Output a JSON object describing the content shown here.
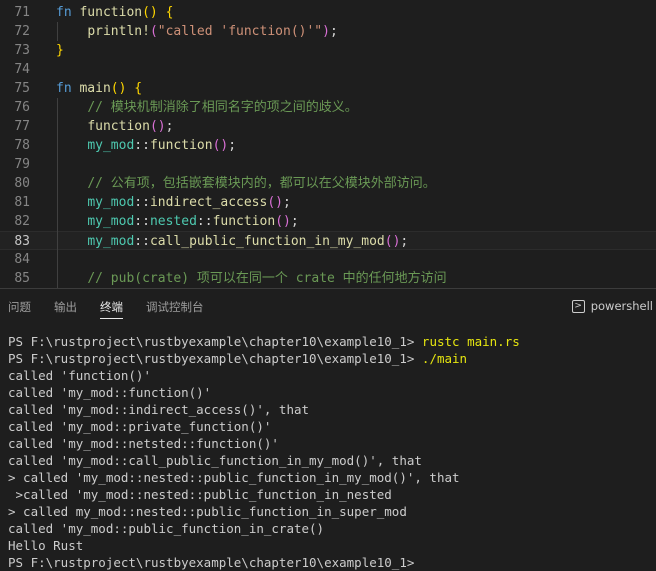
{
  "editor": {
    "lines": [
      {
        "num": "71",
        "tokens": [
          [
            "kw",
            "fn "
          ],
          [
            "fn",
            "function"
          ],
          [
            "br1",
            "() {"
          ]
        ]
      },
      {
        "num": "72",
        "tokens": [
          [
            "pl",
            "    "
          ],
          [
            "fn",
            "println!"
          ],
          [
            "br2",
            "("
          ],
          [
            "str",
            "\"called 'function()'\""
          ],
          [
            "br2",
            ")"
          ],
          [
            "pl",
            ";"
          ]
        ]
      },
      {
        "num": "73",
        "tokens": [
          [
            "br1",
            "}"
          ]
        ]
      },
      {
        "num": "74",
        "tokens": []
      },
      {
        "num": "75",
        "tokens": [
          [
            "kw",
            "fn "
          ],
          [
            "fn",
            "main"
          ],
          [
            "br1",
            "() {"
          ]
        ]
      },
      {
        "num": "76",
        "tokens": [
          [
            "pl",
            "    "
          ],
          [
            "cm",
            "// 模块机制消除了相同名字的项之间的歧义。"
          ]
        ]
      },
      {
        "num": "77",
        "tokens": [
          [
            "pl",
            "    "
          ],
          [
            "fn",
            "function"
          ],
          [
            "br2",
            "()"
          ],
          [
            "pl",
            ";"
          ]
        ]
      },
      {
        "num": "78",
        "tokens": [
          [
            "pl",
            "    "
          ],
          [
            "mod",
            "my_mod"
          ],
          [
            "pl",
            "::"
          ],
          [
            "fn",
            "function"
          ],
          [
            "br2",
            "()"
          ],
          [
            "pl",
            ";"
          ]
        ]
      },
      {
        "num": "79",
        "tokens": []
      },
      {
        "num": "80",
        "tokens": [
          [
            "pl",
            "    "
          ],
          [
            "cm",
            "// 公有项，包括嵌套模块内的，都可以在父模块外部访问。"
          ]
        ]
      },
      {
        "num": "81",
        "tokens": [
          [
            "pl",
            "    "
          ],
          [
            "mod",
            "my_mod"
          ],
          [
            "pl",
            "::"
          ],
          [
            "fn",
            "indirect_access"
          ],
          [
            "br2",
            "()"
          ],
          [
            "pl",
            ";"
          ]
        ]
      },
      {
        "num": "82",
        "tokens": [
          [
            "pl",
            "    "
          ],
          [
            "mod",
            "my_mod"
          ],
          [
            "pl",
            "::"
          ],
          [
            "mod",
            "nested"
          ],
          [
            "pl",
            "::"
          ],
          [
            "fn",
            "function"
          ],
          [
            "br2",
            "()"
          ],
          [
            "pl",
            ";"
          ]
        ]
      },
      {
        "num": "83",
        "tokens": [
          [
            "pl",
            "    "
          ],
          [
            "mod",
            "my_mod"
          ],
          [
            "pl",
            "::"
          ],
          [
            "fn",
            "call_public_function_in_my_mod"
          ],
          [
            "br2",
            "()"
          ],
          [
            "pl",
            ";"
          ]
        ],
        "current": true
      },
      {
        "num": "84",
        "tokens": []
      },
      {
        "num": "85",
        "tokens": [
          [
            "pl",
            "    "
          ],
          [
            "cm",
            "// pub(crate) 项可以在同一个 crate 中的任何地方访问"
          ]
        ]
      }
    ]
  },
  "panel": {
    "tabs": [
      {
        "label": "问题",
        "active": false
      },
      {
        "label": "输出",
        "active": false
      },
      {
        "label": "终端",
        "active": true
      },
      {
        "label": "调试控制台",
        "active": false
      }
    ],
    "shell_label": "powershell"
  },
  "terminal": {
    "lines": [
      {
        "prompt": "PS F:\\rustproject\\rustbyexample\\chapter10\\example10_1> ",
        "cmd": "rustc main.rs"
      },
      {
        "prompt": "PS F:\\rustproject\\rustbyexample\\chapter10\\example10_1> ",
        "cmd": "./main"
      },
      {
        "text": "called 'function()'"
      },
      {
        "text": "called 'my_mod::function()'"
      },
      {
        "text": "called 'my_mod::indirect_access()', that"
      },
      {
        "text": "called 'my_mod::private_function()'"
      },
      {
        "text": "called 'my_mod::netsted::function()'"
      },
      {
        "text": "called 'my_mod::call_public_function_in_my_mod()', that"
      },
      {
        "text": "> called 'my_mod::nested::public_function_in_my_mod()', that"
      },
      {
        "text": " >called 'my_mod::nested::public_function_in_nested"
      },
      {
        "text": "> called my_mod::nested::public_function_in_super_mod"
      },
      {
        "text": "called 'my_mod::public_function_in_crate()"
      },
      {
        "text": "Hello Rust"
      },
      {
        "prompt": "PS F:\\rustproject\\rustbyexample\\chapter10\\example10_1> ",
        "cmd": ""
      }
    ]
  }
}
